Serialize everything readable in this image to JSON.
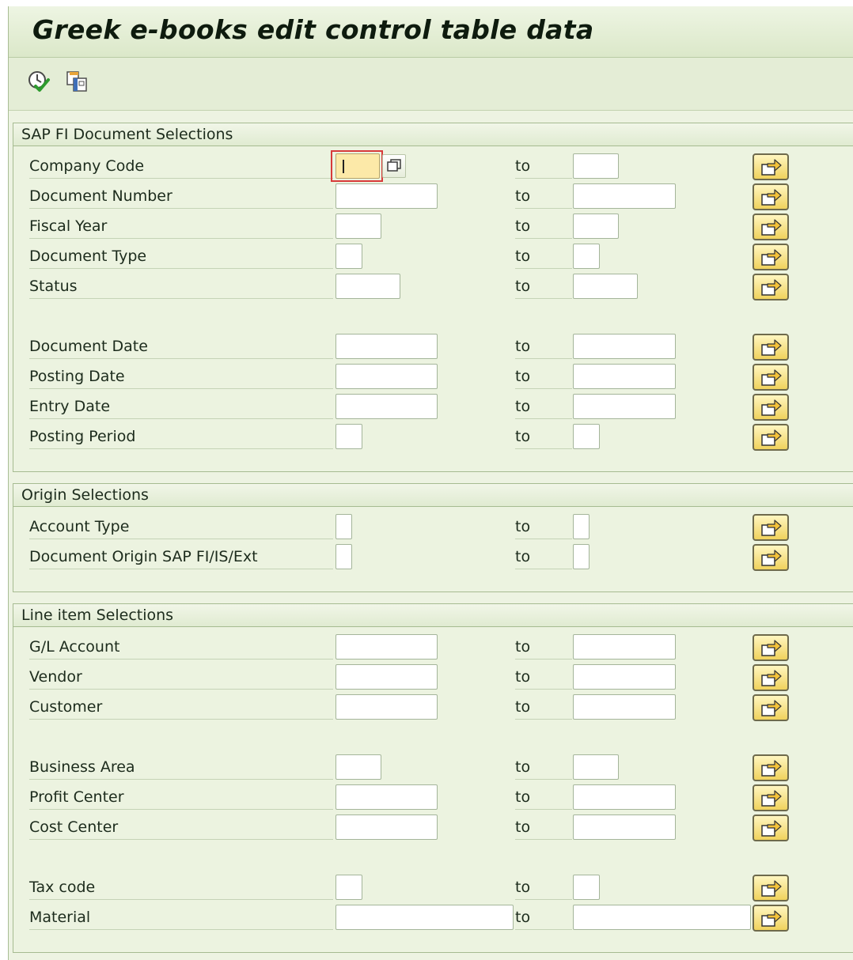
{
  "header": {
    "title": "Greek e-books edit control table data"
  },
  "toolbar": {
    "buttons": [
      {
        "name": "execute-icon"
      },
      {
        "name": "get-variant-icon"
      }
    ]
  },
  "range_separator": "to",
  "sections": [
    {
      "title": "SAP FI Document Selections",
      "fields": [
        {
          "label": "Company Code",
          "value_from": "",
          "value_to": "",
          "focused": true
        },
        {
          "label": "Document Number",
          "value_from": "",
          "value_to": ""
        },
        {
          "label": "Fiscal Year",
          "value_from": "",
          "value_to": ""
        },
        {
          "label": "Document Type",
          "value_from": "",
          "value_to": ""
        },
        {
          "label": "Status",
          "value_from": "",
          "value_to": ""
        },
        {
          "label": "Document Date",
          "value_from": "",
          "value_to": ""
        },
        {
          "label": "Posting Date",
          "value_from": "",
          "value_to": ""
        },
        {
          "label": "Entry Date",
          "value_from": "",
          "value_to": ""
        },
        {
          "label": "Posting Period",
          "value_from": "",
          "value_to": ""
        }
      ]
    },
    {
      "title": "Origin Selections",
      "fields": [
        {
          "label": "Account Type",
          "value_from": "",
          "value_to": ""
        },
        {
          "label": "Document Origin SAP FI/IS/Ext",
          "value_from": "",
          "value_to": ""
        }
      ]
    },
    {
      "title": "Line item Selections",
      "fields": [
        {
          "label": "G/L Account",
          "value_from": "",
          "value_to": ""
        },
        {
          "label": "Vendor",
          "value_from": "",
          "value_to": ""
        },
        {
          "label": "Customer",
          "value_from": "",
          "value_to": ""
        },
        {
          "label": "Business Area",
          "value_from": "",
          "value_to": ""
        },
        {
          "label": "Profit Center",
          "value_from": "",
          "value_to": ""
        },
        {
          "label": "Cost Center",
          "value_from": "",
          "value_to": ""
        },
        {
          "label": "Tax code",
          "value_from": "",
          "value_to": ""
        },
        {
          "label": "Material",
          "value_from": "",
          "value_to": ""
        }
      ]
    }
  ],
  "icons": {
    "multiple_selection": "multiple-selection-arrow-icon",
    "value_help": "value-help-icon"
  },
  "colors": {
    "background": "#edf3e2",
    "focus_frame": "#d83a3a",
    "focused_input": "#fce9a8",
    "multiple_selection_button": "#f0d25d"
  }
}
